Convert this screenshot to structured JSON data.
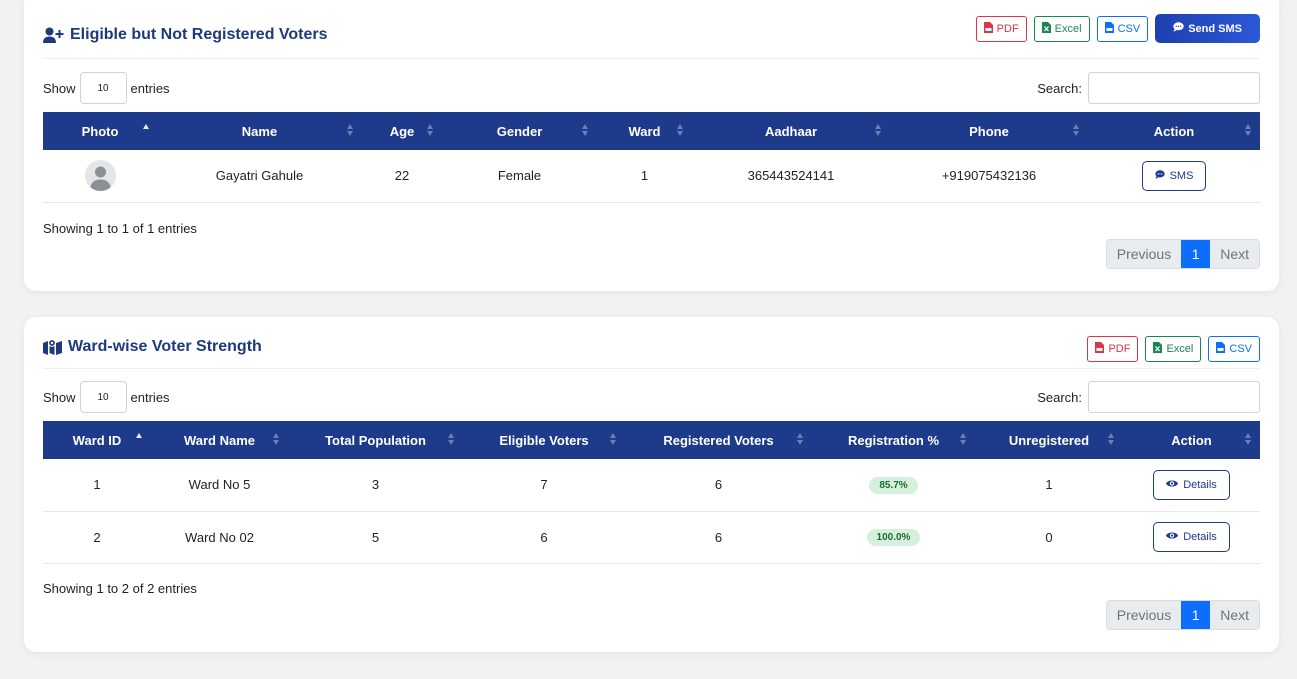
{
  "eligible_section": {
    "title": "Eligible but Not Registered Voters",
    "buttons": {
      "pdf": "PDF",
      "excel": "Excel",
      "csv": "CSV",
      "send_sms": "Send SMS"
    },
    "show_label": "Show",
    "entries_value": "10",
    "entries_label": "entries",
    "search_label": "Search:",
    "columns": [
      "Photo",
      "Name",
      "Age",
      "Gender",
      "Ward",
      "Aadhaar",
      "Phone",
      "Action"
    ],
    "rows": [
      {
        "name": "Gayatri Gahule",
        "age": "22",
        "gender": "Female",
        "ward": "1",
        "aadhaar": "365443524141",
        "phone": "+919075432136",
        "action": "SMS"
      }
    ],
    "info": "Showing 1 to 1 of 1 entries",
    "pagination": {
      "previous": "Previous",
      "current": "1",
      "next": "Next"
    }
  },
  "ward_section": {
    "title": "Ward-wise Voter Strength",
    "buttons": {
      "pdf": "PDF",
      "excel": "Excel",
      "csv": "CSV"
    },
    "show_label": "Show",
    "entries_value": "10",
    "entries_label": "entries",
    "search_label": "Search:",
    "columns": [
      "Ward ID",
      "Ward Name",
      "Total Population",
      "Eligible Voters",
      "Registered Voters",
      "Registration %",
      "Unregistered",
      "Action"
    ],
    "rows": [
      {
        "ward_id": "1",
        "ward_name": "Ward No 5",
        "total_population": "3",
        "eligible_voters": "7",
        "registered_voters": "6",
        "registration_pct": "85.7%",
        "unregistered": "1",
        "action": "Details"
      },
      {
        "ward_id": "2",
        "ward_name": "Ward No 02",
        "total_population": "5",
        "eligible_voters": "6",
        "registered_voters": "6",
        "registration_pct": "100.0%",
        "unregistered": "0",
        "action": "Details"
      }
    ],
    "info": "Showing 1 to 2 of 2 entries",
    "pagination": {
      "previous": "Previous",
      "current": "1",
      "next": "Next"
    }
  },
  "colors": {
    "primary": "#1e3a8a",
    "title": "#1e3a7b",
    "pdf": "#dc3545",
    "excel": "#198754",
    "csv": "#0d6efd",
    "badge_bg": "#d6f0dc"
  }
}
